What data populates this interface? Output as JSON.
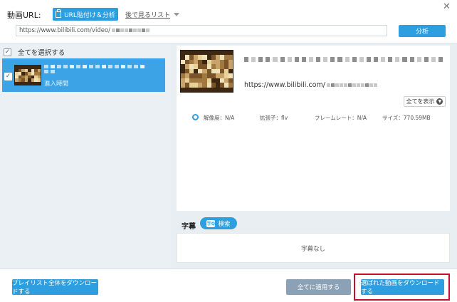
{
  "header": {
    "url_label": "動画URL:",
    "paste_button": "URL貼付け＆分析",
    "watch_later": "後で見るリスト",
    "url_input_value": "https://www.bilibili.com/video/",
    "analyze_button": "分析"
  },
  "left": {
    "select_all": "全てを選択する",
    "item_subtitle": "進入時間"
  },
  "detail": {
    "url_text": "https://www.bilibili.com/",
    "show_all_button": "全てを表示",
    "format": {
      "resolution": "解像度：N/A",
      "extension": "拡張子：flv",
      "framerate": "フレームレート：N/A",
      "size": "サイズ：770.59MB"
    }
  },
  "subtitle": {
    "label": "字幕",
    "search_button": "検索",
    "none_text": "字幕なし"
  },
  "footer": {
    "download_playlist": "プレイリスト全体をダウンロードする",
    "apply_all": "全てに適用する",
    "download_selected": "選ばれた動画をダウンロードする"
  },
  "colors": {
    "accent": "#2d9ee0",
    "selected_item": "#3ba3e6",
    "disabled_button": "#8ba1b5",
    "highlight": "#c8102e"
  },
  "icons": {
    "paste": "clipboard-icon",
    "watch_later_menu": "chevron-down-icon",
    "close": "close-icon",
    "show_all": "chevron-circle-down-icon",
    "search": "subtitle-search-icon"
  }
}
